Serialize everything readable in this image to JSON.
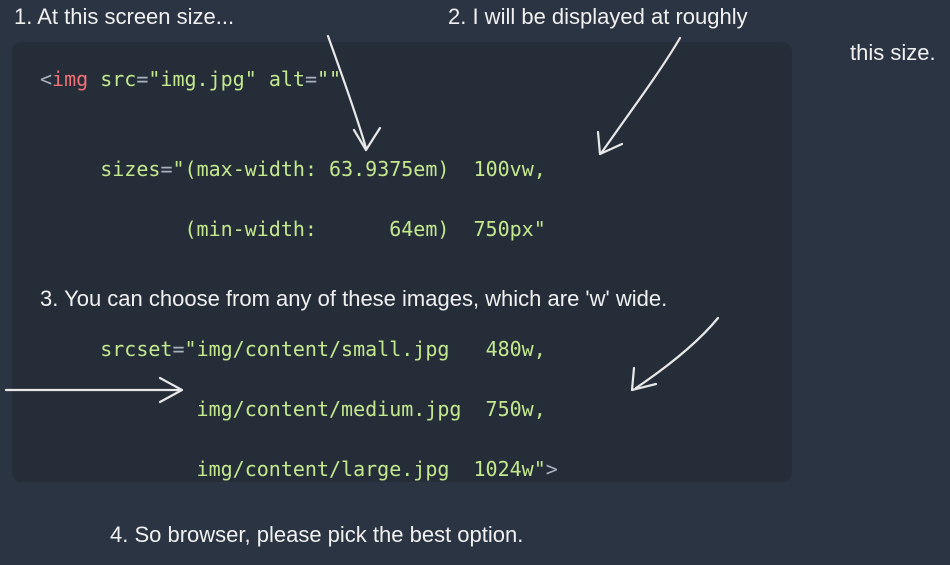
{
  "annotations": {
    "a1": "1. At this screen size...",
    "a2a": "2. I will be displayed at roughly",
    "a2b": "this size.",
    "a3": "3. You can choose from any of these images, which are 'w' wide.",
    "a4": "4. So browser, please pick the best option."
  },
  "code": {
    "tag_open": "<",
    "tag_name": "img",
    "attr_src": "src",
    "val_src": "\"img.jpg\"",
    "attr_alt": "alt",
    "val_alt": "\"\"",
    "attr_sizes": "sizes",
    "sizes_open": "\"",
    "sizes_l1_q": "(max-width: 63.9375em)",
    "sizes_l1_v": "100vw",
    "sizes_comma": ",",
    "sizes_l2_q": "(min-width:      64em)",
    "sizes_l2_v": "750px",
    "sizes_close": "\"",
    "attr_srcset": "srcset",
    "srcset_open": "\"",
    "srcset_l1_p": "img/content/small.jpg",
    "srcset_l1_w": "480w",
    "srcset_l2_p": "img/content/medium.jpg",
    "srcset_l2_w": "750w",
    "srcset_l3_p": "img/content/large.jpg",
    "srcset_l3_w": "1024w",
    "srcset_close": "\"",
    "tag_close": ">"
  }
}
